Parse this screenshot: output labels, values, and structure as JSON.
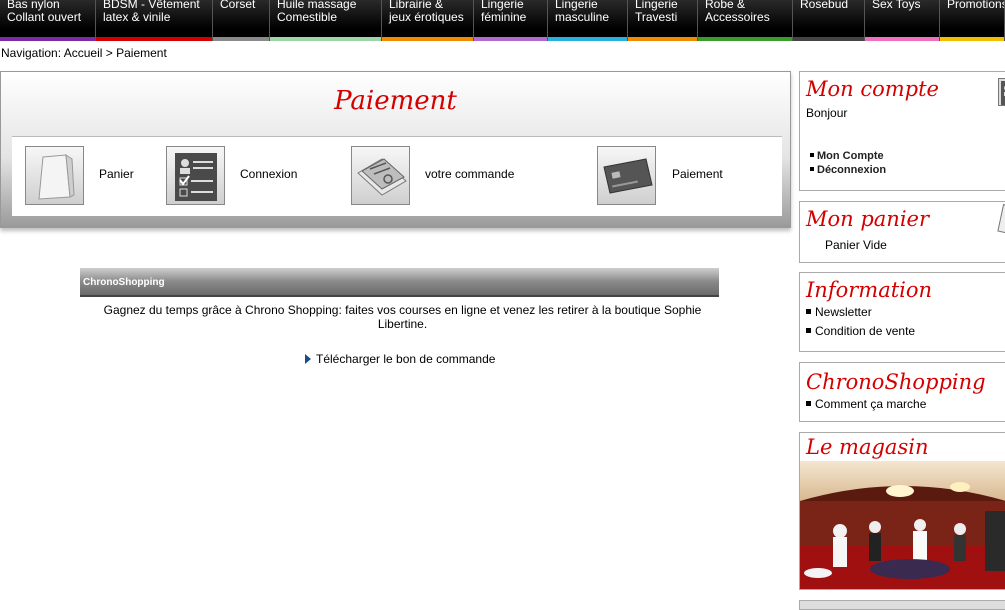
{
  "nav": [
    {
      "label1": "Bas nylon",
      "label2": "Collant ouvert",
      "color": "#7b2aa8",
      "width": 96
    },
    {
      "label1": "BDSM - Vêtement",
      "label2": "latex & vinile",
      "color": "#d40000",
      "width": 117
    },
    {
      "label1": "Corset",
      "label2": "",
      "color": "#8a8a8a",
      "width": 57
    },
    {
      "label1": "Huile massage",
      "label2": "Comestible",
      "color": "#9fd4a8",
      "width": 112
    },
    {
      "label1": "Librairie &",
      "label2": "jeux érotiques",
      "color": "#f08a00",
      "width": 92
    },
    {
      "label1": "Lingerie",
      "label2": "féminine",
      "color": "#b06ad0",
      "width": 74
    },
    {
      "label1": "Lingerie",
      "label2": "masculine",
      "color": "#2ab0e0",
      "width": 80
    },
    {
      "label1": "Lingerie",
      "label2": "Travesti",
      "color": "#f08a00",
      "width": 70
    },
    {
      "label1": "Robe &",
      "label2": "Accessoires",
      "color": "#3a9a2a",
      "width": 95
    },
    {
      "label1": "Rosebud",
      "label2": "",
      "color": "#444444",
      "width": 72
    },
    {
      "label1": "Sex Toys",
      "label2": "",
      "color": "#f070c0",
      "width": 75
    },
    {
      "label1": "Promotions",
      "label2": "",
      "color": "#f0c000",
      "width": 65
    }
  ],
  "breadcrumb": {
    "prefix": "Navigation:",
    "home": "Accueil",
    "separator": ">",
    "current": "Paiement"
  },
  "payment": {
    "title": "Paiement",
    "steps": [
      {
        "label": "Panier",
        "icon": "shopping-bag-icon"
      },
      {
        "label": "Connexion",
        "icon": "form-checklist-icon"
      },
      {
        "label": "votre commande",
        "icon": "paper-order-icon"
      },
      {
        "label": "Paiement",
        "icon": "credit-card-icon"
      }
    ]
  },
  "chrono": {
    "header": "ChronoShopping",
    "text": "Gagnez du temps grâce à Chrono Shopping: faites vos courses en ligne et venez les retirer à la boutique Sophie Libertine.",
    "download": "Télécharger le bon de commande"
  },
  "sidebar": {
    "account": {
      "title": "Mon compte",
      "greeting": "Bonjour",
      "links": [
        "Mon Compte",
        "Déconnexion"
      ]
    },
    "cart": {
      "title": "Mon panier",
      "status": "Panier Vide"
    },
    "info": {
      "title": "Information",
      "links": [
        "Newsletter",
        "Condition de vente"
      ]
    },
    "chrono": {
      "title": "ChronoShopping",
      "links": [
        "Comment ça marche"
      ]
    },
    "store": {
      "title": "Le magasin"
    }
  },
  "colors": {
    "accent": "#d40000",
    "link_arrow": "#1a4d8c"
  }
}
